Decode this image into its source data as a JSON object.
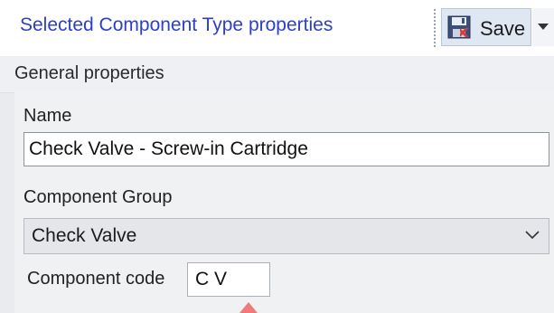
{
  "header": {
    "title": "Selected Component Type properties",
    "save_label": "Save",
    "save_icon": "save-disk-icon",
    "dropdown_icon": "caret-down-icon"
  },
  "section": {
    "title": "General properties"
  },
  "fields": {
    "name_label": "Name",
    "name_value": "Check Valve - Screw-in Cartridge",
    "group_label": "Component Group",
    "group_value": "Check Valve",
    "code_label": "Component code",
    "code_value": "C V"
  },
  "colors": {
    "title_blue": "#2b3fc9",
    "pointer_red": "#f07a7a"
  }
}
